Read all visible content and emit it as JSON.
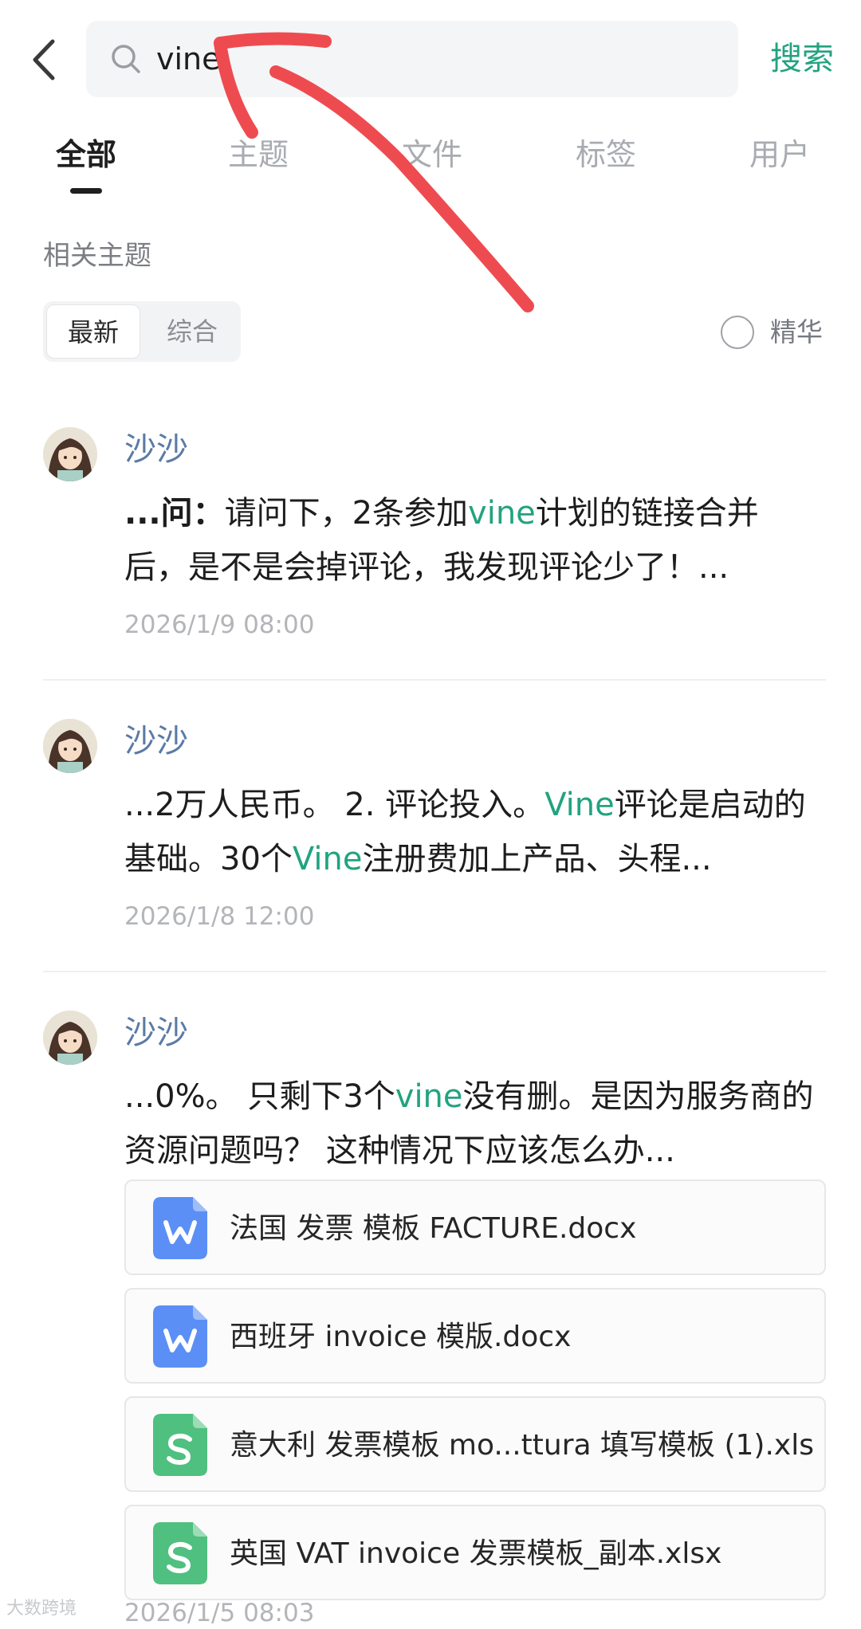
{
  "header": {
    "search_value": "vine",
    "search_button": "搜索"
  },
  "tabs": [
    {
      "label": "全部",
      "active": true
    },
    {
      "label": "主题"
    },
    {
      "label": "文件"
    },
    {
      "label": "标签"
    },
    {
      "label": "用户"
    }
  ],
  "section": {
    "title": "相关主题",
    "sort_options": [
      "最新",
      "综合"
    ],
    "sort_selected": "最新",
    "essence_label": "精华"
  },
  "posts": [
    {
      "author": "沙沙",
      "content_parts": [
        {
          "text": "...问：",
          "bold": true
        },
        {
          "text": "请问下，2条参加"
        },
        {
          "text": "vine",
          "highlight": true
        },
        {
          "text": "计划的链接合并后，是不是会掉评论，我发现评论少了！..."
        }
      ],
      "date": "2026/1/9 08:00"
    },
    {
      "author": "沙沙",
      "content_parts": [
        {
          "text": "...2万人民币。 2. 评论投入。"
        },
        {
          "text": "Vine",
          "highlight": true
        },
        {
          "text": "评论是启动的基础。30个"
        },
        {
          "text": "Vine",
          "highlight": true
        },
        {
          "text": "注册费加上产品、头程..."
        }
      ],
      "date": "2026/1/8 12:00"
    },
    {
      "author": "沙沙",
      "content_parts": [
        {
          "text": "...0%。 只剩下3个"
        },
        {
          "text": "vine",
          "highlight": true
        },
        {
          "text": "没有删。是因为服务商的资源问题吗？ 这种情况下应该怎么办..."
        }
      ],
      "files": [
        {
          "name": "法国 发票 模板 FACTURE.docx",
          "type": "word-icon"
        },
        {
          "name": "西班牙 invoice 模版.docx",
          "type": "word-icon"
        },
        {
          "name": "意大利 发票模板 mo...ttura 填写模板 (1).xls",
          "type": "sheet-icon"
        },
        {
          "name": "英国 VAT invoice 发票模板_副本.xlsx",
          "type": "sheet-icon"
        }
      ],
      "date": "2026/1/5 08:03"
    }
  ],
  "watermark": "大数跨境",
  "colors": {
    "accent": "#22a37f",
    "author": "#5b7aa6",
    "word_icon": "#5b8ff6",
    "sheet_icon": "#4fc07f",
    "annotation_arrow": "#ee4b50"
  }
}
